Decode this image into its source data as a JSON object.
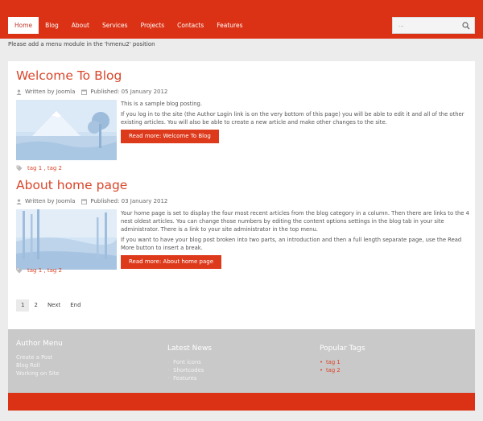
{
  "nav": {
    "items": [
      {
        "label": "Home",
        "active": true
      },
      {
        "label": "Blog"
      },
      {
        "label": "About"
      },
      {
        "label": "Services"
      },
      {
        "label": "Projects"
      },
      {
        "label": "Contacts"
      },
      {
        "label": "Features"
      }
    ]
  },
  "search": {
    "placeholder": "..."
  },
  "notice": "Please add a menu module in the 'hmenu2' position",
  "articles": [
    {
      "title": "Welcome To Blog",
      "author": "Written by Joomla",
      "published": "Published: 05 January 2012",
      "paragraphs": [
        "This is a sample blog posting.",
        "If you log in to the site (the Author Login link is on the very bottom of this page) you will be able to edit it and all of the other existing articles. You will also be able to create a new article and make other changes to the site."
      ],
      "button": "Read more: Welcome To Blog",
      "tags": "tag 1 , tag 2"
    },
    {
      "title": "About home page",
      "author": "Written by Joomla",
      "published": "Published: 03 January 2012",
      "paragraphs": [
        "Your home page is set to display the four most recent articles from the blog category in a column. Then there are links to the 4 nest oldest articles. You can change those numbers by editing the content options settings in the blog tab in your site administrator. There is a link to your site administrator in the top menu.",
        "If you want to have your blog post broken into two parts, an introduction and then a full length separate page, use the Read More button to insert a break."
      ],
      "button": "Read more: About home page",
      "tags": "tag 1 , tag 2"
    }
  ],
  "pagination": {
    "pages": [
      "1",
      "2"
    ],
    "next": "Next",
    "end": "End",
    "current": "1"
  },
  "footer": {
    "author_menu": {
      "title": "Author Menu",
      "links": [
        "Create a Post",
        "Blog Roll",
        "Working on Site"
      ]
    },
    "latest_news": {
      "title": "Latest News",
      "links": [
        "Font icons",
        "Shortcodes",
        "Features"
      ]
    },
    "popular_tags": {
      "title": "Popular Tags",
      "links": [
        "tag 1",
        "tag 2"
      ]
    }
  },
  "colors": {
    "accent": "#db3215",
    "title": "#d9462a",
    "footer_bg": "#c9c9c9",
    "page_bg": "#ececec"
  },
  "icons": [
    "user-icon",
    "calendar-icon",
    "tag-icon",
    "search-icon"
  ]
}
